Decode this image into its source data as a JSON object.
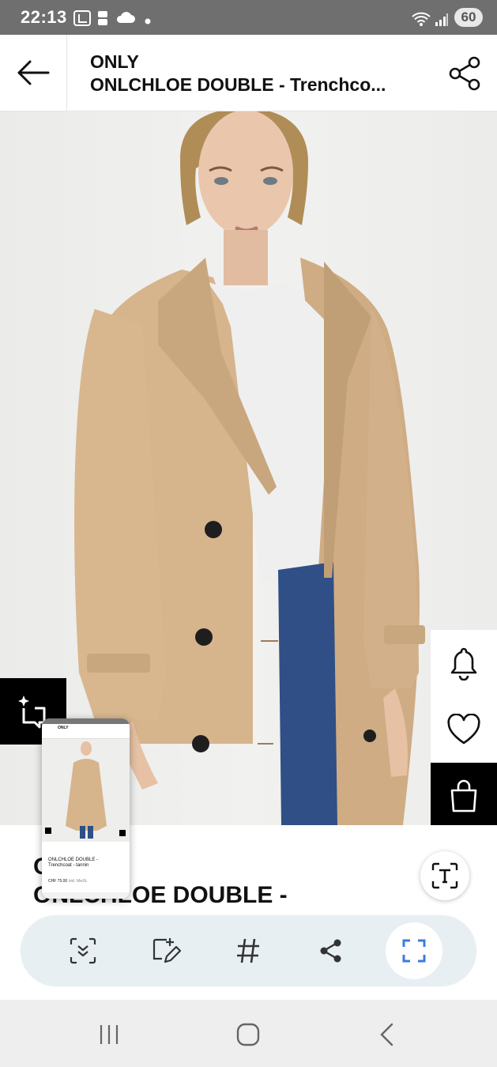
{
  "status_bar": {
    "time": "22:13",
    "battery": "60"
  },
  "header": {
    "brand": "ONLY",
    "product_title": "ONLCHLOE DOUBLE - Trenchco..."
  },
  "product_info": {
    "brand": "O",
    "name": "ONLCHLOE DOUBLE -"
  },
  "thumbnail": {
    "brand": "ONLY",
    "title_line1": "ONLCHLOE DOUBLE -",
    "title_line2": "Trenchcoat - tannin",
    "price": "CHF 75.00",
    "price_note": "inkl. MwSt."
  },
  "icons": {
    "back": "arrow-left-icon",
    "share": "share-icon",
    "bell": "bell-icon",
    "heart": "heart-icon",
    "bag": "shopping-bag-icon",
    "ai_compare": "ai-compare-icon",
    "text_extract": "text-extract-icon",
    "scroll_capture": "scroll-capture-icon",
    "draw": "draw-icon",
    "hashtag": "hashtag-icon",
    "share_tool": "share-icon",
    "crop": "crop-icon"
  },
  "colors": {
    "status_bar": "#6f6f6f",
    "coat": "#d6b48c",
    "jeans": "#2f4f86",
    "toolbar": "#e7eff3",
    "crop_accent": "#3a7be0"
  }
}
